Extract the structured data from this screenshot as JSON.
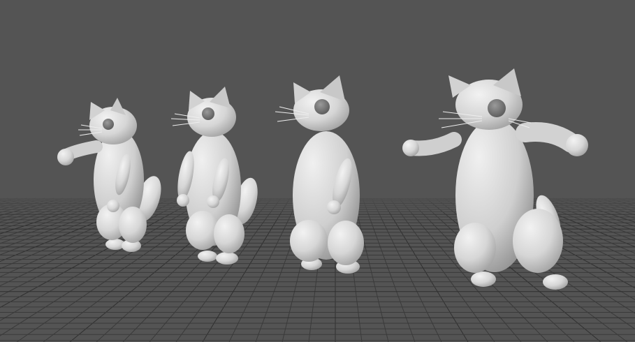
{
  "viewport": {
    "background_color": "#545454",
    "grid_color": "#3a3a3a",
    "grid_major_color": "#2f2f2f",
    "model_color": "#d8d8d8"
  },
  "scene": {
    "grid": "on",
    "characters": [
      {
        "name": "cat",
        "pose": "reaching-left-arm"
      },
      {
        "name": "cat",
        "pose": "standing-arms-down"
      },
      {
        "name": "cat",
        "pose": "standing-arms-down"
      },
      {
        "name": "cat",
        "pose": "arms-out-walking"
      }
    ]
  }
}
